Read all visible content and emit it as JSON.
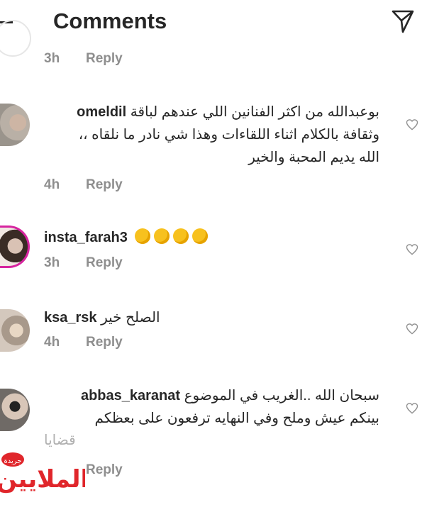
{
  "header": {
    "title": "Comments"
  },
  "prev": {
    "time": "3h",
    "reply": "Reply"
  },
  "comments": [
    {
      "username": "omeldil",
      "lines": [
        "بوعبدالله من اكثر الفنانين اللي عندهم لباقة",
        "وثقافة بالكلام اثناء اللقاءات وهذا شي نادر ما نلقاه ،،",
        "الله يديم المحبة والخير"
      ],
      "time": "4h",
      "reply": "Reply"
    },
    {
      "username": "insta_farah3",
      "time": "3h",
      "reply": "Reply"
    },
    {
      "username": "ksa_rsk",
      "lines": [
        "الصلح خير"
      ],
      "time": "4h",
      "reply": "Reply"
    },
    {
      "username": "abbas_karanat",
      "lines": [
        "سبحان الله ..الغريب في الموضوع",
        "بينكم عيش وملح وفي النهايه ترفعون على بعظكم",
        "قضايا"
      ],
      "reply": "Reply"
    }
  ],
  "watermark": {
    "small": "جريدة",
    "big": "الملايين"
  },
  "colors": {
    "text": "#262626",
    "meta": "#8e8e8e",
    "story_ring": "#d6249f",
    "emoji": "#f7c11e",
    "watermark": "#e0262b"
  },
  "icons": [
    "back-arrow-icon",
    "send-icon",
    "heart-icon"
  ]
}
